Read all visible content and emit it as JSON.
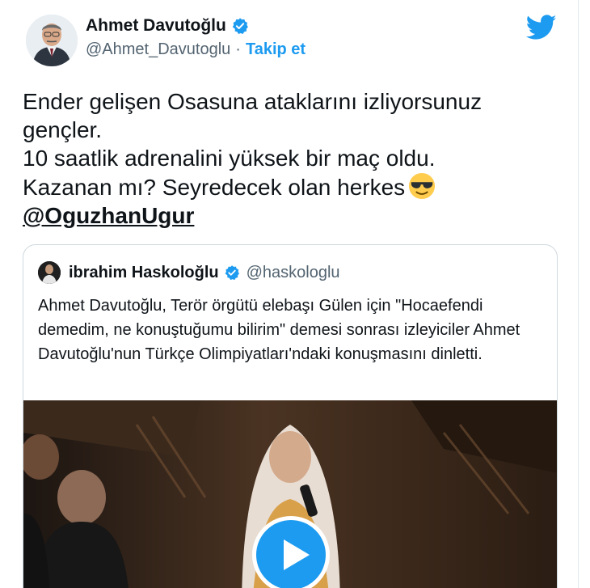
{
  "author": {
    "display_name": "Ahmet Davutoğlu",
    "handle": "@Ahmet_Davutoglu",
    "separator": "·",
    "follow_label": "Takip et"
  },
  "tweet": {
    "lines": [
      "Ender gelişen Osasuna ataklarını izliyorsunuz",
      "gençler.",
      "10 saatlik adrenalini yüksek bir maç oldu.",
      "Kazanan mı? Seyredecek olan herkes"
    ],
    "emoji": "smiling-face-with-sunglasses",
    "mention": "@OguzhanUgur"
  },
  "quoted": {
    "display_name": "ibrahim Haskoloğlu",
    "handle": "@haskologlu",
    "text": "Ahmet Davutoğlu, Terör örgütü elebaşı Gülen için \"Hocaefendi demedim, ne konuştuğumu bilirim\" demesi sonrası izleyiciler Ahmet Davutoğlu'nun Türkçe Olimpiyatları'ndaki konuşmasını dinletti."
  },
  "icons": {
    "brand": "twitter-bird-icon",
    "verified": "verified-badge-icon",
    "play": "play-icon"
  },
  "colors": {
    "accent": "#1d9bf0",
    "text": "#0f1419",
    "secondary": "#536471",
    "border": "#cfd9de"
  }
}
